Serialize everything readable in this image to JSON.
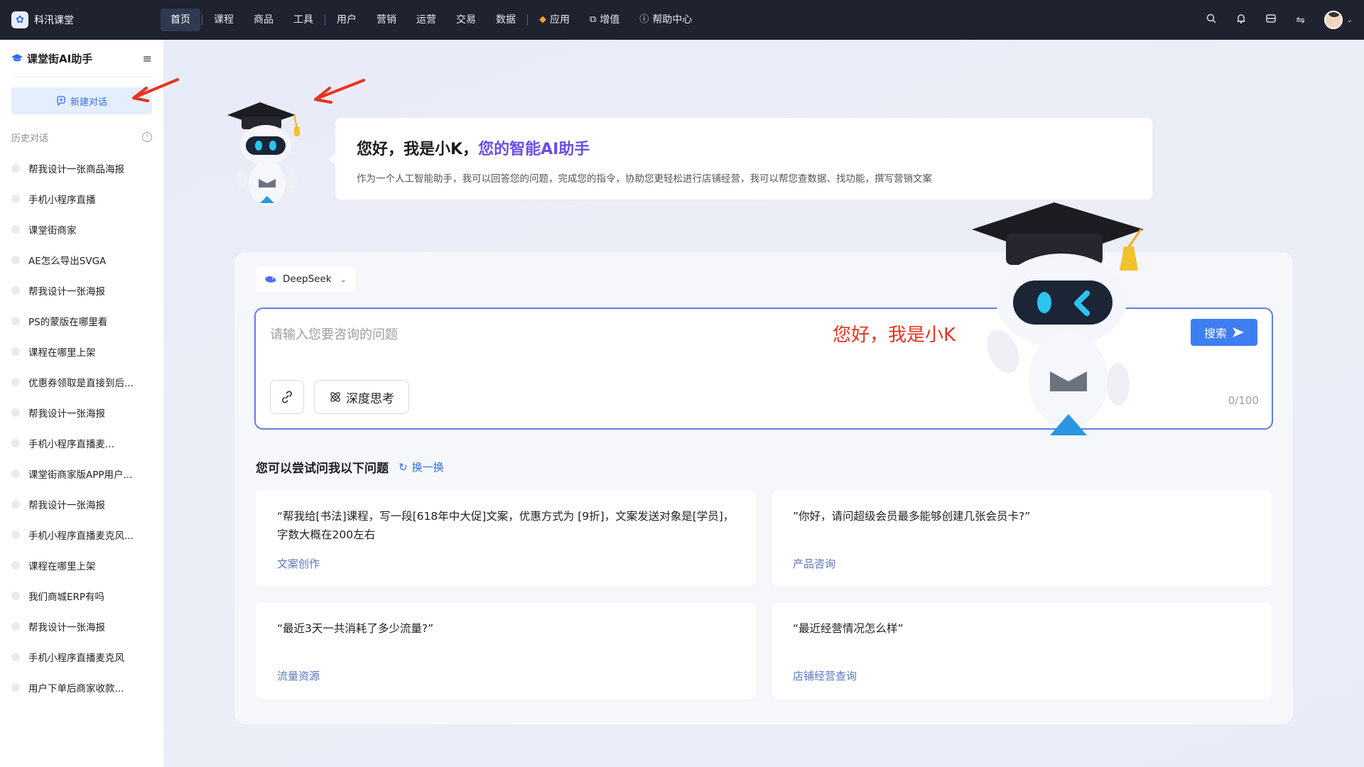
{
  "brand": {
    "name": "科汛课堂"
  },
  "nav": {
    "items": [
      "首页",
      "课程",
      "商品",
      "工具",
      "用户",
      "营销",
      "运营",
      "交易",
      "数据",
      "应用",
      "增值",
      "帮助中心"
    ]
  },
  "sidebar": {
    "title": "课堂街AI助手",
    "new_chat": "新建对话",
    "history_label": "历史对话",
    "history": [
      "帮我设计一张商品海报",
      "手机小程序直播",
      "课堂街商家",
      "AE怎么导出SVGA",
      "帮我设计一张海报",
      "PS的蒙版在哪里看",
      "课程在哪里上架",
      "优惠券领取是直接到后...",
      "帮我设计一张海报",
      "手机小程序直播麦...",
      "课堂街商家版APP用户...",
      "帮我设计一张海报",
      "手机小程序直播麦克风...",
      "课程在哪里上架",
      "我们商城ERP有吗",
      "帮我设计一张海报",
      "手机小程序直播麦克风",
      "用户下单后商家收款..."
    ]
  },
  "greeting": {
    "title_prefix": "您好，我是小K，",
    "title_accent": "您的智能AI助手",
    "subtitle": "作为一个人工智能助手，我可以回答您的问题，完成您的指令，协助您更轻松进行店铺经营，我可以帮您查数据、找功能，撰写营销文案"
  },
  "composer": {
    "model": "DeepSeek",
    "placeholder": "请输入您要咨询的问题",
    "hello_text": "您好，我是小K",
    "search_label": "搜索",
    "deep_think_label": "深度思考",
    "counter": "0/100"
  },
  "suggestions": {
    "title": "您可以尝试问我以下问题",
    "refresh": "换一换",
    "cards": [
      {
        "question": "“帮我给[书法]课程，写一段[618年中大促]文案，优惠方式为 [9折]，文案发送对象是[学员]，字数大概在200左右",
        "tag": "文案创作"
      },
      {
        "question": "”你好，请问超级会员最多能够创建几张会员卡?”",
        "tag": "产品咨询"
      },
      {
        "question": "“最近3天一共消耗了多少流量?”",
        "tag": "流量资源"
      },
      {
        "question": "“最近经营情况怎么样”",
        "tag": "店铺经营查询"
      }
    ]
  },
  "colors": {
    "accent": "#3f7ef2",
    "purple": "#6b4de6",
    "red": "#e8331f",
    "topbar": "#1f2330"
  }
}
